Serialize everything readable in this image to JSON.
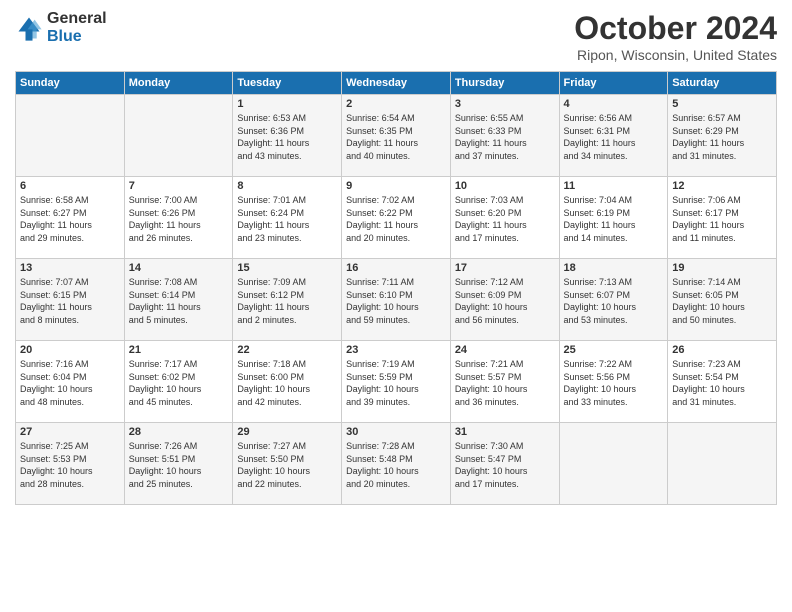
{
  "logo": {
    "general": "General",
    "blue": "Blue"
  },
  "header": {
    "title": "October 2024",
    "location": "Ripon, Wisconsin, United States"
  },
  "days": [
    "Sunday",
    "Monday",
    "Tuesday",
    "Wednesday",
    "Thursday",
    "Friday",
    "Saturday"
  ],
  "weeks": [
    [
      {
        "day": "",
        "info": ""
      },
      {
        "day": "",
        "info": ""
      },
      {
        "day": "1",
        "info": "Sunrise: 6:53 AM\nSunset: 6:36 PM\nDaylight: 11 hours\nand 43 minutes."
      },
      {
        "day": "2",
        "info": "Sunrise: 6:54 AM\nSunset: 6:35 PM\nDaylight: 11 hours\nand 40 minutes."
      },
      {
        "day": "3",
        "info": "Sunrise: 6:55 AM\nSunset: 6:33 PM\nDaylight: 11 hours\nand 37 minutes."
      },
      {
        "day": "4",
        "info": "Sunrise: 6:56 AM\nSunset: 6:31 PM\nDaylight: 11 hours\nand 34 minutes."
      },
      {
        "day": "5",
        "info": "Sunrise: 6:57 AM\nSunset: 6:29 PM\nDaylight: 11 hours\nand 31 minutes."
      }
    ],
    [
      {
        "day": "6",
        "info": "Sunrise: 6:58 AM\nSunset: 6:27 PM\nDaylight: 11 hours\nand 29 minutes."
      },
      {
        "day": "7",
        "info": "Sunrise: 7:00 AM\nSunset: 6:26 PM\nDaylight: 11 hours\nand 26 minutes."
      },
      {
        "day": "8",
        "info": "Sunrise: 7:01 AM\nSunset: 6:24 PM\nDaylight: 11 hours\nand 23 minutes."
      },
      {
        "day": "9",
        "info": "Sunrise: 7:02 AM\nSunset: 6:22 PM\nDaylight: 11 hours\nand 20 minutes."
      },
      {
        "day": "10",
        "info": "Sunrise: 7:03 AM\nSunset: 6:20 PM\nDaylight: 11 hours\nand 17 minutes."
      },
      {
        "day": "11",
        "info": "Sunrise: 7:04 AM\nSunset: 6:19 PM\nDaylight: 11 hours\nand 14 minutes."
      },
      {
        "day": "12",
        "info": "Sunrise: 7:06 AM\nSunset: 6:17 PM\nDaylight: 11 hours\nand 11 minutes."
      }
    ],
    [
      {
        "day": "13",
        "info": "Sunrise: 7:07 AM\nSunset: 6:15 PM\nDaylight: 11 hours\nand 8 minutes."
      },
      {
        "day": "14",
        "info": "Sunrise: 7:08 AM\nSunset: 6:14 PM\nDaylight: 11 hours\nand 5 minutes."
      },
      {
        "day": "15",
        "info": "Sunrise: 7:09 AM\nSunset: 6:12 PM\nDaylight: 11 hours\nand 2 minutes."
      },
      {
        "day": "16",
        "info": "Sunrise: 7:11 AM\nSunset: 6:10 PM\nDaylight: 10 hours\nand 59 minutes."
      },
      {
        "day": "17",
        "info": "Sunrise: 7:12 AM\nSunset: 6:09 PM\nDaylight: 10 hours\nand 56 minutes."
      },
      {
        "day": "18",
        "info": "Sunrise: 7:13 AM\nSunset: 6:07 PM\nDaylight: 10 hours\nand 53 minutes."
      },
      {
        "day": "19",
        "info": "Sunrise: 7:14 AM\nSunset: 6:05 PM\nDaylight: 10 hours\nand 50 minutes."
      }
    ],
    [
      {
        "day": "20",
        "info": "Sunrise: 7:16 AM\nSunset: 6:04 PM\nDaylight: 10 hours\nand 48 minutes."
      },
      {
        "day": "21",
        "info": "Sunrise: 7:17 AM\nSunset: 6:02 PM\nDaylight: 10 hours\nand 45 minutes."
      },
      {
        "day": "22",
        "info": "Sunrise: 7:18 AM\nSunset: 6:00 PM\nDaylight: 10 hours\nand 42 minutes."
      },
      {
        "day": "23",
        "info": "Sunrise: 7:19 AM\nSunset: 5:59 PM\nDaylight: 10 hours\nand 39 minutes."
      },
      {
        "day": "24",
        "info": "Sunrise: 7:21 AM\nSunset: 5:57 PM\nDaylight: 10 hours\nand 36 minutes."
      },
      {
        "day": "25",
        "info": "Sunrise: 7:22 AM\nSunset: 5:56 PM\nDaylight: 10 hours\nand 33 minutes."
      },
      {
        "day": "26",
        "info": "Sunrise: 7:23 AM\nSunset: 5:54 PM\nDaylight: 10 hours\nand 31 minutes."
      }
    ],
    [
      {
        "day": "27",
        "info": "Sunrise: 7:25 AM\nSunset: 5:53 PM\nDaylight: 10 hours\nand 28 minutes."
      },
      {
        "day": "28",
        "info": "Sunrise: 7:26 AM\nSunset: 5:51 PM\nDaylight: 10 hours\nand 25 minutes."
      },
      {
        "day": "29",
        "info": "Sunrise: 7:27 AM\nSunset: 5:50 PM\nDaylight: 10 hours\nand 22 minutes."
      },
      {
        "day": "30",
        "info": "Sunrise: 7:28 AM\nSunset: 5:48 PM\nDaylight: 10 hours\nand 20 minutes."
      },
      {
        "day": "31",
        "info": "Sunrise: 7:30 AM\nSunset: 5:47 PM\nDaylight: 10 hours\nand 17 minutes."
      },
      {
        "day": "",
        "info": ""
      },
      {
        "day": "",
        "info": ""
      }
    ]
  ]
}
